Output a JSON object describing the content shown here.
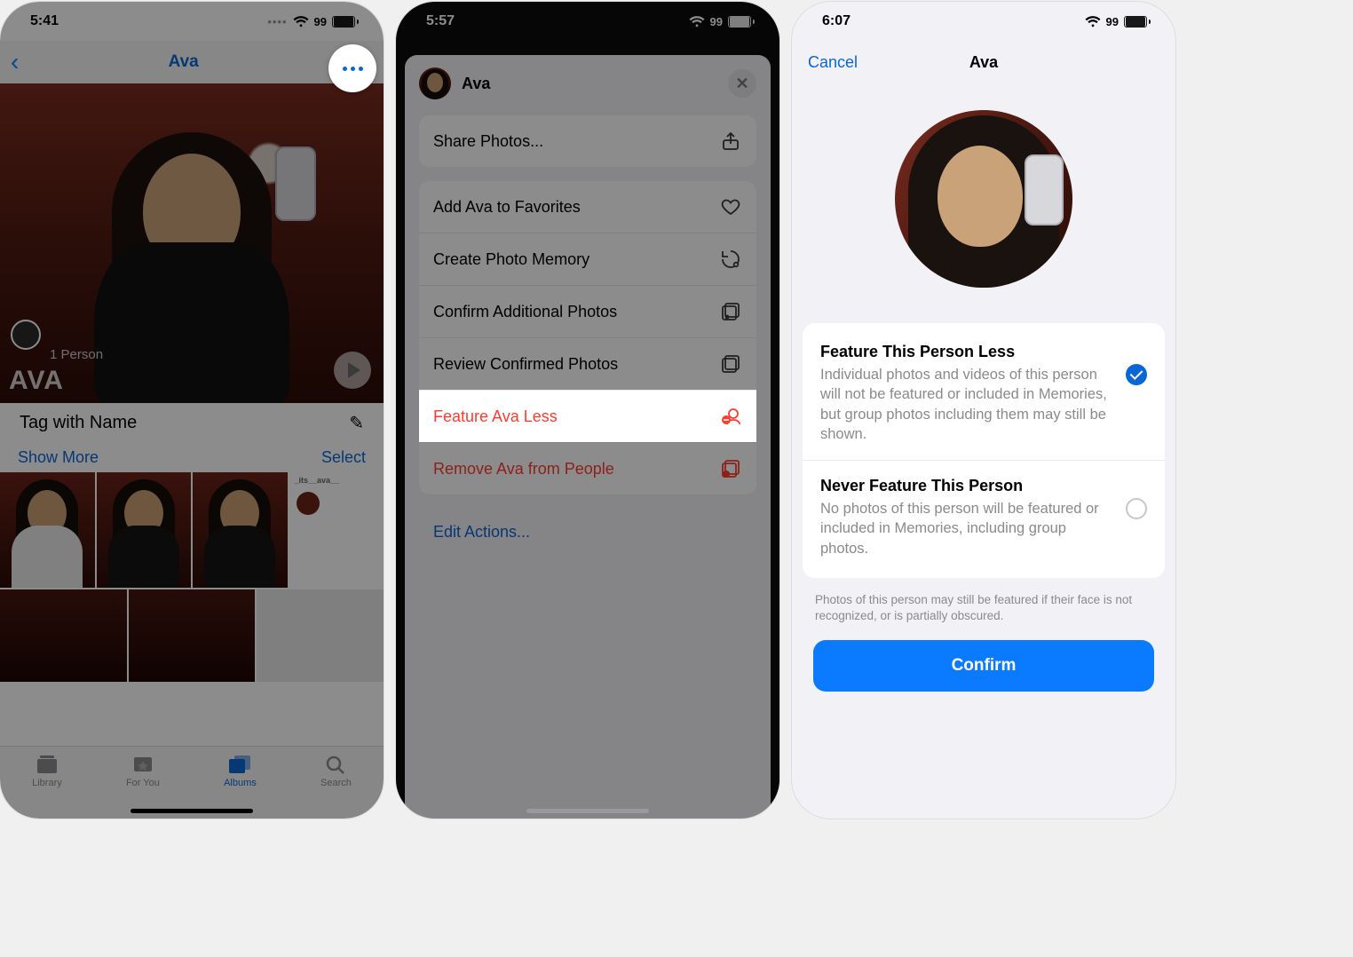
{
  "screen1": {
    "time": "5:41",
    "battery": "99",
    "nav_title": "Ava",
    "hero_name": "AVA",
    "one_person": "1 Person",
    "tag_with_name": "Tag with Name",
    "show_more": "Show More",
    "select": "Select",
    "ig_handle": "_its__ava__",
    "tabs": {
      "library": "Library",
      "for_you": "For You",
      "albums": "Albums",
      "search": "Search"
    }
  },
  "screen2": {
    "time": "5:57",
    "battery": "99",
    "name": "Ava",
    "rows": {
      "share": "Share Photos...",
      "favorite": "Add Ava to Favorites",
      "memory": "Create Photo Memory",
      "confirm": "Confirm Additional Photos",
      "review": "Review Confirmed Photos",
      "feature_less": "Feature Ava Less",
      "remove": "Remove Ava from People"
    },
    "edit_actions": "Edit Actions..."
  },
  "screen3": {
    "time": "6:07",
    "battery": "99",
    "cancel": "Cancel",
    "title": "Ava",
    "opt1_title": "Feature This Person Less",
    "opt1_desc": "Individual photos and videos of this person will not be featured or included in Memories, but group photos including them may still be shown.",
    "opt2_title": "Never Feature This Person",
    "opt2_desc": "No photos of this person will be featured or included in Memories, including group photos.",
    "footnote": "Photos of this person may still be featured if their face is not recognized, or is partially obscured.",
    "confirm": "Confirm"
  }
}
